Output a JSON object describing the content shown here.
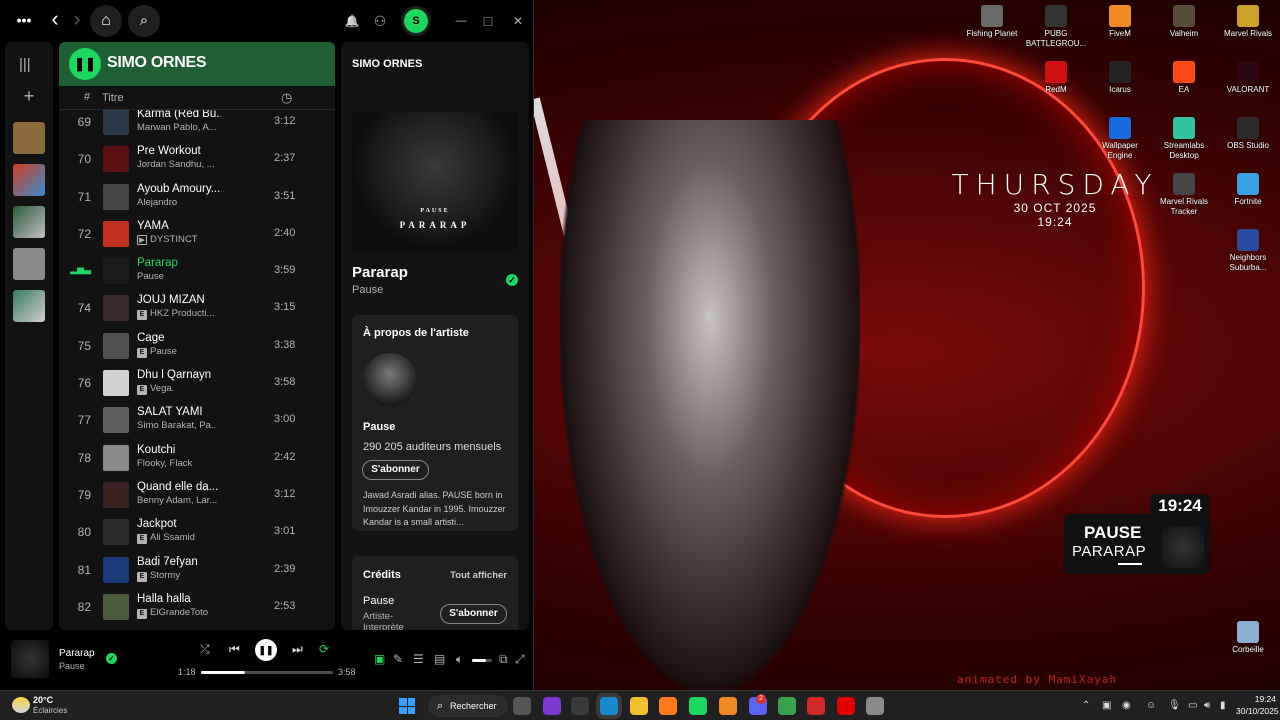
{
  "desktop": {
    "clock_widget": {
      "day": "THURSDAY",
      "date": "30 OCT 2025",
      "time": "19:24"
    },
    "watermark": "animated by MamiXayah",
    "icons": [
      {
        "label": "Fishing Planet",
        "color": "#6a6a6a"
      },
      {
        "label": "PUBG BATTLEGROU...",
        "color": "#333333"
      },
      {
        "label": "FiveM",
        "color": "#f08a24"
      },
      {
        "label": "Valheim",
        "color": "#5a4a3a"
      },
      {
        "label": "Marvel Rivals",
        "color": "#c9a227"
      },
      {
        "label": "RedM",
        "color": "#d01010"
      },
      {
        "label": "Icarus",
        "color": "#222222"
      },
      {
        "label": "EA",
        "color": "#ff4a1a"
      },
      {
        "label": "VALORANT",
        "color": "#2a0a10"
      },
      {
        "label": "Wallpaper Engine",
        "color": "#1a6adf"
      },
      {
        "label": "Streamlabs Desktop",
        "color": "#31c3a2"
      },
      {
        "label": "OBS Studio",
        "color": "#2a2a2a"
      },
      {
        "label": "Marvel Rivals Tracker",
        "color": "#444444"
      },
      {
        "label": "Fortnite",
        "color": "#3aa0e0"
      },
      {
        "label": "Neighbors Suburba...",
        "color": "#2a4aa0"
      },
      {
        "label": "Corbeille",
        "color": "#8ab0d0"
      }
    ],
    "music_widget": {
      "time": "19:24",
      "artist": "PAUSE",
      "track": "PARARAP"
    }
  },
  "spotify": {
    "titlebar": {
      "menu": "•••",
      "back": "‹",
      "forward": "›",
      "home": "⌂",
      "search": "⌕",
      "bell": "🔔",
      "friends": "⚇",
      "avatar": "S",
      "minimize": "—",
      "maximize": "□",
      "close": "✕"
    },
    "library": {
      "toggle": "|||",
      "add": "+"
    },
    "playlist": {
      "title": "SIMO ORNES",
      "play_icon": "❚❚",
      "col_number": "#",
      "col_title": "Titre",
      "col_duration": "◷",
      "tracks": [
        {
          "n": "69",
          "title": "Karma (Red Bu...",
          "artist": "Marwan Pablo, A...",
          "explicit": false,
          "duration": "3:12",
          "cover": "#2a3a4a"
        },
        {
          "n": "70",
          "title": "Pre Workout",
          "artist": "Jordan Sandhu, ...",
          "explicit": false,
          "duration": "2:37",
          "cover": "#5a1010"
        },
        {
          "n": "71",
          "title": "Ayoub Amoury...",
          "artist": "Alejandro",
          "explicit": false,
          "duration": "3:51",
          "cover": "#444444"
        },
        {
          "n": "72",
          "title": "YAMA",
          "artist": "DYSTINCT",
          "explicit": false,
          "video": true,
          "duration": "2:40",
          "cover": "#c03020"
        },
        {
          "n": "",
          "title": "Pararap",
          "artist": "Pause",
          "explicit": false,
          "duration": "3:59",
          "cover": "#1a1a1a",
          "active": true
        },
        {
          "n": "74",
          "title": "JOUJ MIZAN",
          "artist": "HKZ Producti...",
          "explicit": true,
          "duration": "3:15",
          "cover": "#3a2a2a"
        },
        {
          "n": "75",
          "title": "Cage",
          "artist": "Pause",
          "explicit": true,
          "duration": "3:38",
          "cover": "#505050"
        },
        {
          "n": "76",
          "title": "Dhu l Qarnayn",
          "artist": "Vega.",
          "explicit": true,
          "duration": "3:58",
          "cover": "#d0d0d0"
        },
        {
          "n": "77",
          "title": "SALAT YAMI",
          "artist": "Simo Barakat, Pa...",
          "explicit": false,
          "duration": "3:00",
          "cover": "#606060"
        },
        {
          "n": "78",
          "title": "Koutchi",
          "artist": "Flooky, Flack",
          "explicit": false,
          "duration": "2:42",
          "cover": "#8a8a8a"
        },
        {
          "n": "79",
          "title": "Quand elle da...",
          "artist": "Benny Adam, Lar...",
          "explicit": false,
          "duration": "3:12",
          "cover": "#3a2020"
        },
        {
          "n": "80",
          "title": "Jackpot",
          "artist": "Ali Ssamid",
          "explicit": true,
          "duration": "3:01",
          "cover": "#2a2a2a"
        },
        {
          "n": "81",
          "title": "Badi 7efyan",
          "artist": "Stormy",
          "explicit": true,
          "duration": "2:39",
          "cover": "#1a3a7a"
        },
        {
          "n": "82",
          "title": "Halla halla",
          "artist": "ElGrandeToto",
          "explicit": true,
          "duration": "2:53",
          "cover": "#4a5a3a"
        }
      ]
    },
    "now_playing": {
      "header": "SIMO ORNES",
      "cover_caption_small": "PAUSE",
      "cover_caption": "PARARAP",
      "track": "Pararap",
      "artist": "Pause",
      "about_title": "À propos de l'artiste",
      "about_artist": "Pause",
      "listeners": "290 205 auditeurs mensuels",
      "follow_label": "S'abonner",
      "bio": "Jawad Asradi alias. PAUSE born in Imouzzer Kandar in 1995. Imouzzer Kandar is a small artisti...",
      "credits_title": "Crédits",
      "credits_show_all": "Tout afficher",
      "credit_name": "Pause",
      "credit_role": "Artiste-Interprète",
      "credit_follow": "S'abonner"
    },
    "player": {
      "track": "Pararap",
      "artist": "Pause",
      "elapsed": "1:18",
      "total": "3:58",
      "progress": 0.33,
      "volume": 0.7
    }
  },
  "taskbar": {
    "weather_temp": "20°C",
    "weather_desc": "Éclaircies",
    "search_label": "Rechercher",
    "time": "19:24",
    "date": "30/10/2025",
    "discord_badge": "2",
    "apps": [
      {
        "name": "task-view",
        "color": "#555555"
      },
      {
        "name": "app-purple",
        "color": "#7a3ad0"
      },
      {
        "name": "app-photos",
        "color": "#3a3a3a"
      },
      {
        "name": "edge",
        "color": "#1a8ad0"
      },
      {
        "name": "file-explorer",
        "color": "#f0c030"
      },
      {
        "name": "firefox",
        "color": "#ff7a1a"
      },
      {
        "name": "spotify",
        "color": "#1ed760"
      },
      {
        "name": "fivem",
        "color": "#f08a24"
      },
      {
        "name": "discord",
        "color": "#5865f2"
      },
      {
        "name": "chrome",
        "color": "#3aa050"
      },
      {
        "name": "app-red",
        "color": "#d02a2a"
      },
      {
        "name": "netflix",
        "color": "#e00000"
      },
      {
        "name": "steam-ring",
        "color": "#8a8a8a"
      }
    ]
  }
}
